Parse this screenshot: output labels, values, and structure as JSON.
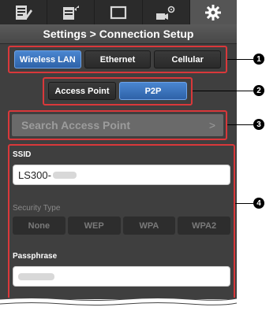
{
  "tabs": [
    {
      "icon": "list-edit-icon"
    },
    {
      "icon": "export-list-icon"
    },
    {
      "icon": "display-window-icon"
    },
    {
      "icon": "camera-settings-icon"
    },
    {
      "icon": "gear-icon",
      "active": true
    }
  ],
  "header": {
    "title": "Settings > Connection Setup"
  },
  "connection_types": {
    "selected": "Wireless LAN",
    "options": [
      "Wireless LAN",
      "Ethernet",
      "Cellular"
    ]
  },
  "wifi_modes": {
    "selected": "P2P",
    "options": [
      "Access Point",
      "P2P"
    ]
  },
  "search_access_point": {
    "label": "Search Access Point",
    "chevron": ">"
  },
  "ssid": {
    "label": "SSID",
    "value": "LS300-"
  },
  "security_type": {
    "label": "Security Type",
    "options": [
      "None",
      "WEP",
      "WPA",
      "WPA2"
    ]
  },
  "passphrase": {
    "label": "Passphrase"
  },
  "callouts": [
    "1",
    "2",
    "3",
    "4"
  ],
  "colors": {
    "highlight_frame": "#d9383a",
    "selected_segment": "#3a74bf",
    "screen_background": "#3f3f3f"
  }
}
